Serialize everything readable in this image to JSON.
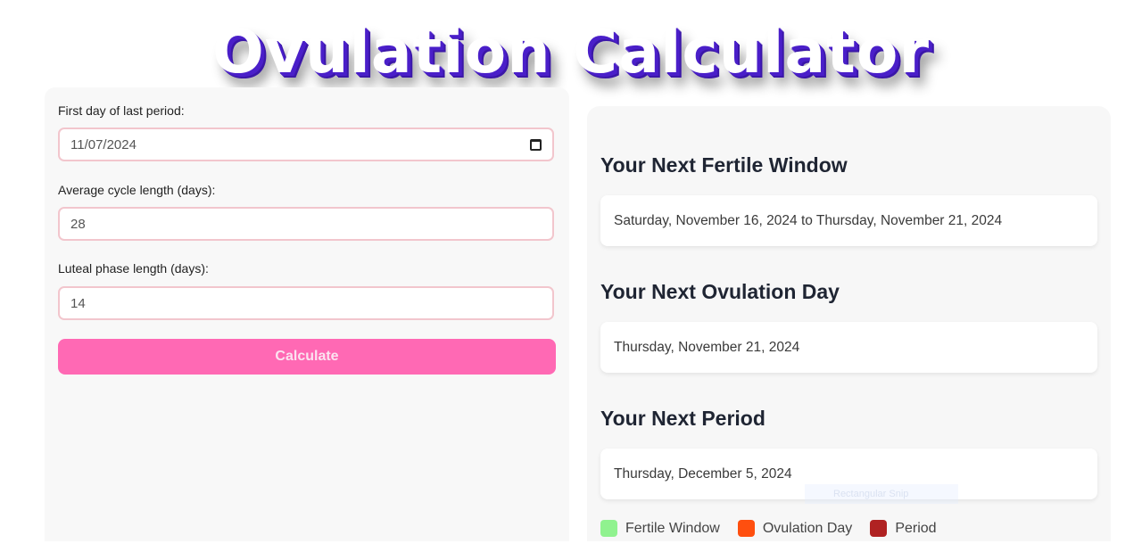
{
  "page": {
    "title": "Ovulation Calculator"
  },
  "form": {
    "last_period": {
      "label": "First day of last period:",
      "value": "11/07/2024",
      "icon": "calendar-icon"
    },
    "cycle_length": {
      "label": "Average cycle length (days):",
      "value": "28"
    },
    "luteal_length": {
      "label": "Luteal phase length (days):",
      "value": "14"
    },
    "calculate_label": "Calculate"
  },
  "results": {
    "fertile_window": {
      "heading": "Your Next Fertile Window",
      "value": "Saturday, November 16, 2024 to Thursday, November 21, 2024"
    },
    "ovulation_day": {
      "heading": "Your Next Ovulation Day",
      "value": "Thursday, November 21, 2024"
    },
    "next_period": {
      "heading": "Your Next Period",
      "value": "Thursday, December 5, 2024"
    }
  },
  "legend": [
    {
      "label": "Fertile Window",
      "color": "#90f28f"
    },
    {
      "label": "Ovulation Day",
      "color": "#ff4f0f"
    },
    {
      "label": "Period",
      "color": "#b02222"
    }
  ],
  "overlay": {
    "snip_label": "Rectangular Snip"
  },
  "colors": {
    "accent": "#ff69b4",
    "input_border": "#f2c6cd",
    "title_shadow": "#4a1fc9"
  }
}
